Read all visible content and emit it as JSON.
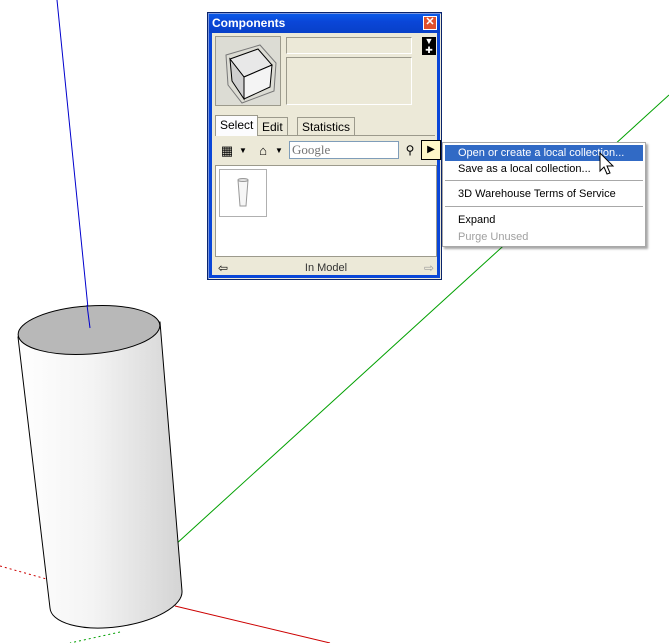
{
  "window": {
    "title": "Components",
    "close_glyph": "✕",
    "component_name": "",
    "component_description": ""
  },
  "tabs": [
    {
      "label": "Select",
      "active": true
    },
    {
      "label": "Edit",
      "active": false
    },
    {
      "label": "Statistics",
      "active": false
    }
  ],
  "toolbar": {
    "view_options_icon": "grid-icon",
    "home_icon": "home-icon",
    "search_placeholder": "Google",
    "search_icon": "magnifier-icon",
    "details_icon": "details-arrow-icon"
  },
  "footer": {
    "collection_label": "In Model",
    "back_icon": "arrow-left-icon",
    "forward_icon": "arrow-right-icon"
  },
  "context_menu": {
    "items": [
      {
        "label": "Open or create a local collection...",
        "highlighted": true,
        "disabled": false
      },
      {
        "label": "Save as a local collection...",
        "highlighted": false,
        "disabled": false
      },
      {
        "label": "3D Warehouse Terms of Service",
        "highlighted": false,
        "disabled": false
      },
      {
        "label": "Expand",
        "highlighted": false,
        "disabled": false
      },
      {
        "label": "Purge Unused",
        "highlighted": false,
        "disabled": true
      }
    ]
  },
  "colors": {
    "title_bar": "#0a46d8",
    "menu_highlight": "#316ac5",
    "axis_blue": "#0000cc",
    "axis_green": "#00a000",
    "axis_red": "#cc0000"
  }
}
